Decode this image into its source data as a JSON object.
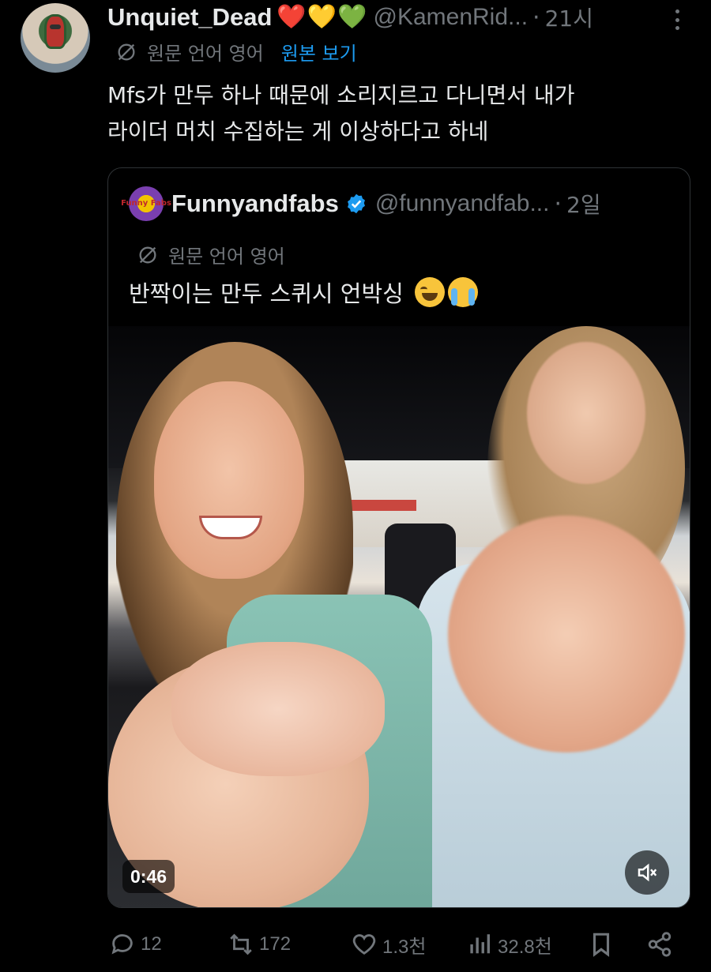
{
  "tweet": {
    "author_name": "Unquiet_Dead",
    "name_emojis": [
      "❤️",
      "💛",
      "💚"
    ],
    "handle": "@KamenRid...",
    "separator": "·",
    "time": "21시",
    "translate_label": "원문 언어 영어",
    "view_original_label": "원본 보기",
    "text_lines": [
      "Mfs가 만두 하나 때문에 소리지르고 다니면서 내가",
      "라이더 머치 수집하는 게 이상하다고 하네"
    ]
  },
  "quoted": {
    "author_name": "Funnyandfabs",
    "avatar_text": "Funny Fabs",
    "handle": "@funnyandfab...",
    "separator": "·",
    "time": "2일",
    "translate_label": "원문 언어 영어",
    "text": "반짝이는 만두 스퀴시 언박싱",
    "emojis": [
      "laughing-crying-emoji",
      "loudly-crying-emoji"
    ],
    "video": {
      "duration": "0:46",
      "muted": true
    }
  },
  "actions": {
    "replies": "12",
    "reposts": "172",
    "likes": "1.3천",
    "views": "32.8천"
  },
  "colors": {
    "background": "#000000",
    "text_primary": "#e7e9ea",
    "text_secondary": "#71767b",
    "accent": "#1d9bf0",
    "border": "#2f3336"
  }
}
